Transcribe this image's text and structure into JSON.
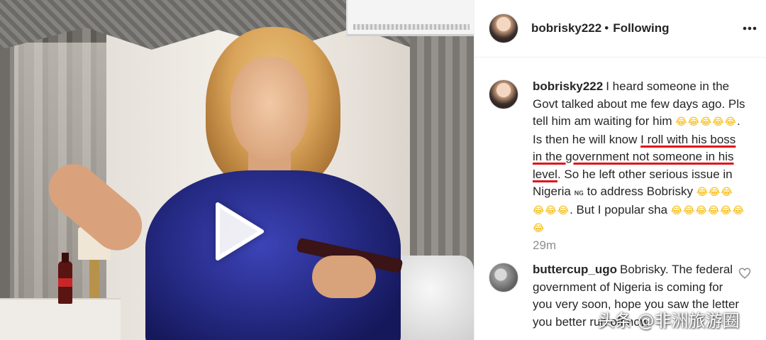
{
  "header": {
    "username": "bobrisky222",
    "separator": "•",
    "follow_status": "Following",
    "more_icon": "more-horizontal-icon"
  },
  "media": {
    "type": "video",
    "play_icon": "play-icon"
  },
  "caption": {
    "username": "bobrisky222",
    "text_part1": "I heard someone in the Govt talked about me few days ago. Pls tell him am waiting for him",
    "emoji_1": "😂😂😂😂😂",
    "text_part2": ". Is then he will know ",
    "highlighted": "I roll with his boss in the government not someone in his level",
    "text_part3": ". So he left other serious issue in Nigeria",
    "flag": "ɴɢ",
    "text_part4": " to address Bobrisky",
    "emoji_2": "😂😂😂😂😂😂",
    "text_part5": ". But I popular sha",
    "emoji_3": "😂😂😂😂😂😂😂",
    "highlight_color": "#e0121c"
  },
  "timestamp": "29m",
  "reply": {
    "username": "buttercup_ugo",
    "text": "Bobrisky. The federal government of Nigeria is coming for you very soon, hope you saw the letter you better run off now",
    "like_icon": "heart-outline-icon"
  },
  "watermark": "头条 @非洲旅游圈"
}
